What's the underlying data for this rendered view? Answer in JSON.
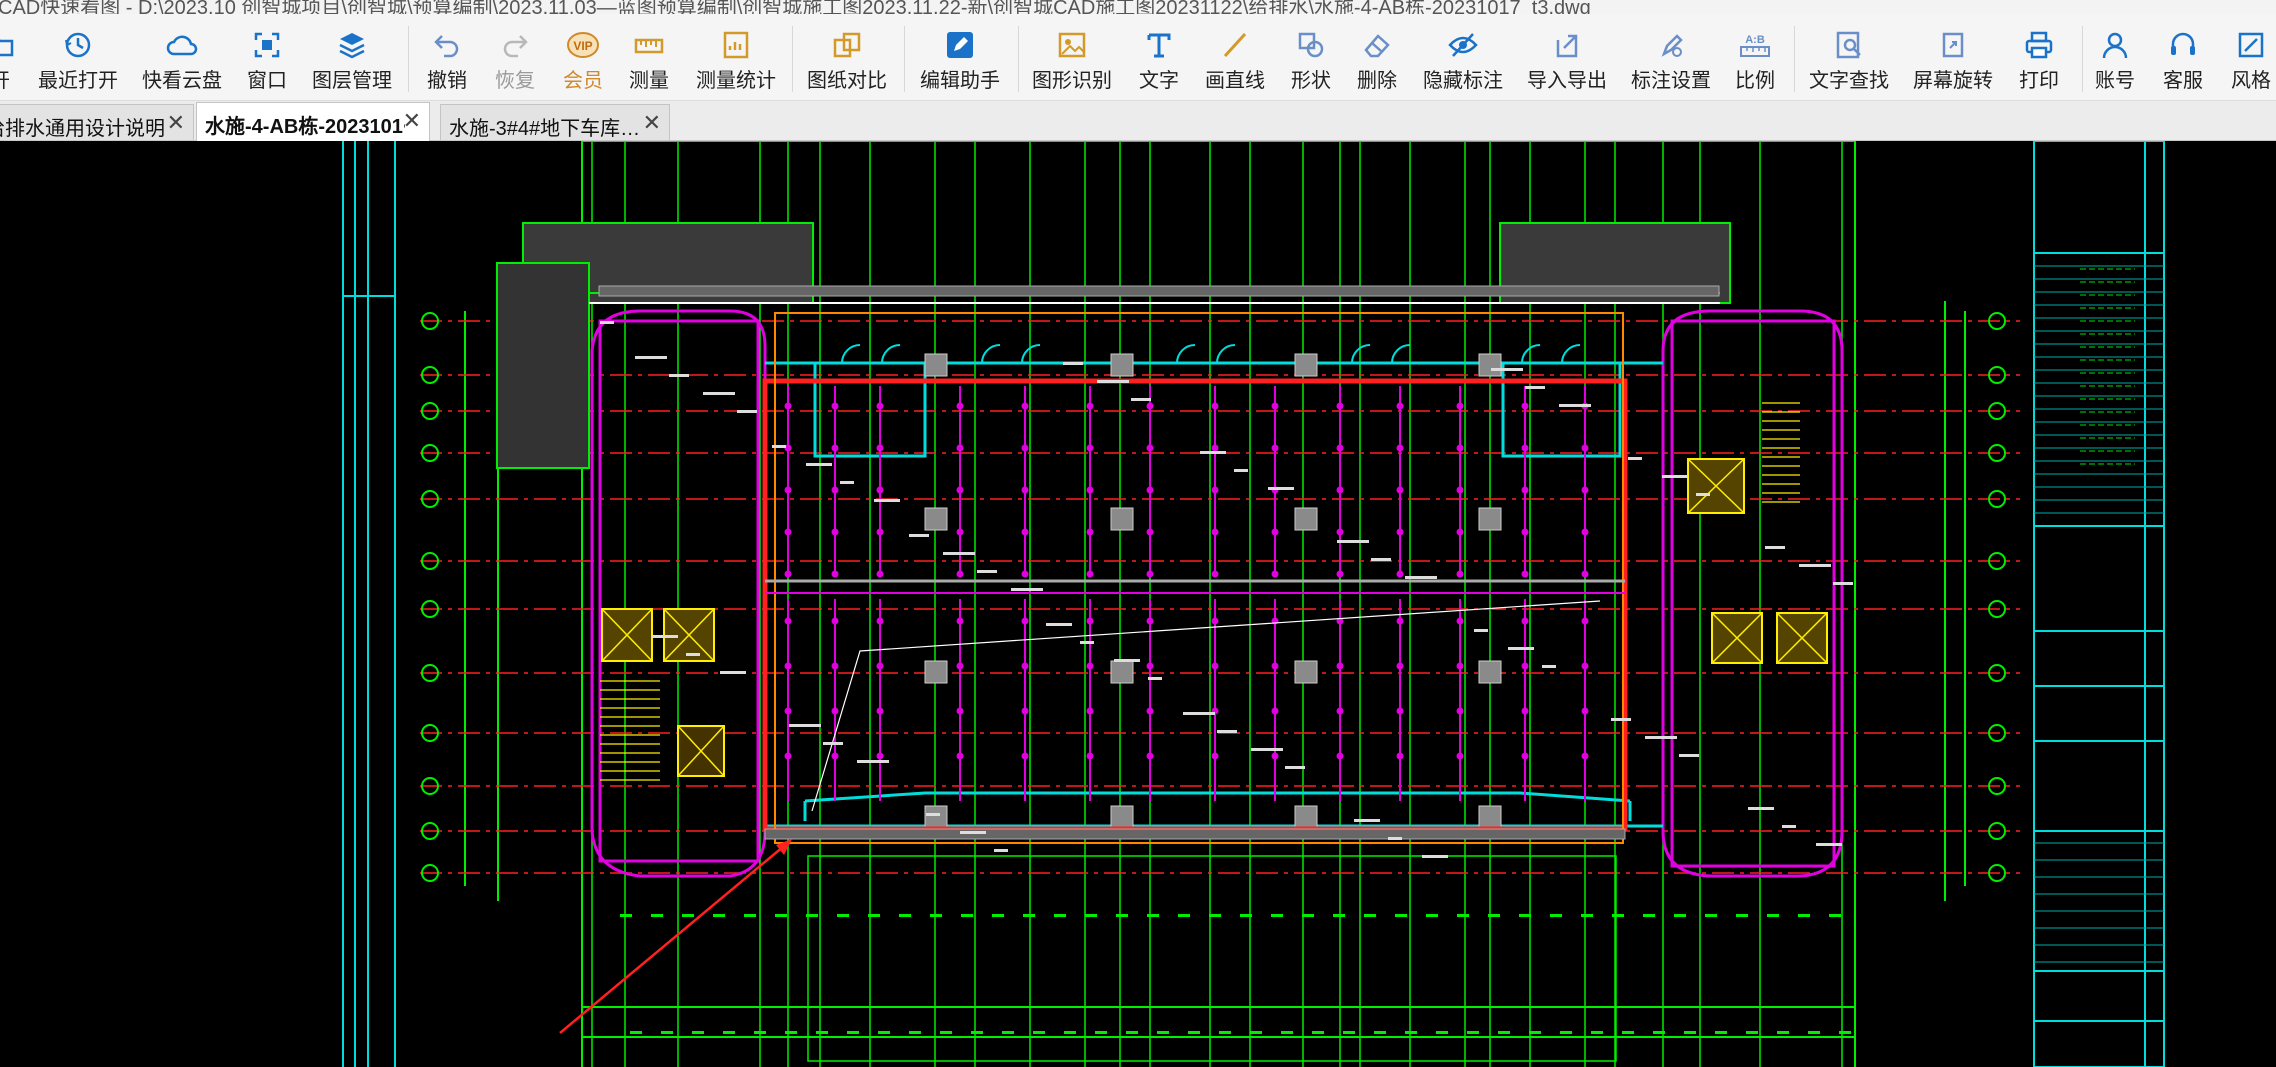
{
  "window": {
    "title": "CAD快速看图 - D:\\2023.10 创智城项目\\创智城\\预算编制\\2023.11.03—蓝图预算编制\\创智城施工图2023.11.22-新\\创智城CAD施工图20231122\\给排水\\水施-4-AB栋-20231017_t3.dwg"
  },
  "toolbar": {
    "items": [
      {
        "label": "开",
        "icon": "open-folder-icon"
      },
      {
        "label": "最近打开",
        "icon": "recent-clock-icon"
      },
      {
        "label": "快看云盘",
        "icon": "cloud-icon"
      },
      {
        "label": "窗口",
        "icon": "window-icon"
      },
      {
        "label": "图层管理",
        "icon": "layers-icon"
      },
      {
        "label": "撤销",
        "icon": "undo-icon"
      },
      {
        "label": "恢复",
        "icon": "redo-icon"
      },
      {
        "label": "会员",
        "icon": "vip-icon"
      },
      {
        "label": "测量",
        "icon": "ruler-icon"
      },
      {
        "label": "测量统计",
        "icon": "measure-stats-icon"
      },
      {
        "label": "图纸对比",
        "icon": "compare-icon"
      },
      {
        "label": "编辑助手",
        "icon": "edit-assistant-icon"
      },
      {
        "label": "图形识别",
        "icon": "shape-recognize-icon"
      },
      {
        "label": "文字",
        "icon": "text-icon"
      },
      {
        "label": "画直线",
        "icon": "line-icon"
      },
      {
        "label": "形状",
        "icon": "shape-icon"
      },
      {
        "label": "删除",
        "icon": "eraser-icon"
      },
      {
        "label": "隐藏标注",
        "icon": "hide-annotation-icon"
      },
      {
        "label": "导入导出",
        "icon": "import-export-icon"
      },
      {
        "label": "标注设置",
        "icon": "annotation-settings-icon"
      },
      {
        "label": "比例",
        "icon": "scale-icon"
      },
      {
        "label": "文字查找",
        "icon": "text-search-icon"
      },
      {
        "label": "屏幕旋转",
        "icon": "rotate-screen-icon"
      },
      {
        "label": "打印",
        "icon": "printer-icon"
      },
      {
        "label": "账号",
        "icon": "account-icon"
      },
      {
        "label": "客服",
        "icon": "headset-icon"
      },
      {
        "label": "风格",
        "icon": "style-icon"
      }
    ]
  },
  "tabs": [
    {
      "label": "给排水通用设计说明",
      "close": "✕"
    },
    {
      "label": "水施-4-AB栋-2023101·",
      "close": "✕",
      "active": true
    },
    {
      "label": "水施-3#4#地下车库…",
      "close": "✕"
    }
  ],
  "colors": {
    "accent": "#1a73c8",
    "cad_red": "#ff2020",
    "cad_green": "#00ee00",
    "cad_magenta": "#e000e0",
    "cad_cyan": "#00dddd",
    "cad_yellow": "#ffee00"
  }
}
